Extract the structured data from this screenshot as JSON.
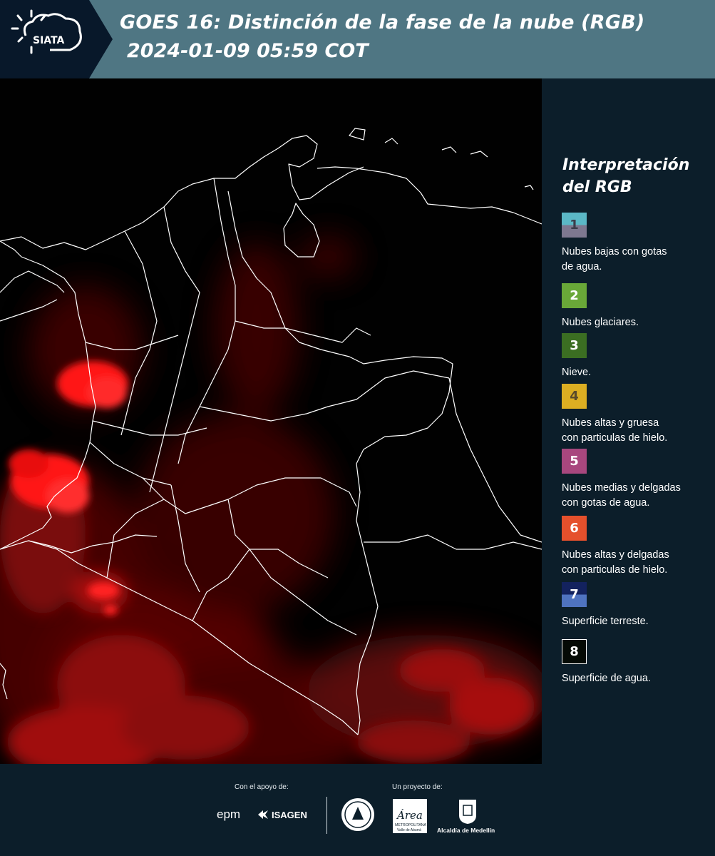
{
  "header": {
    "logo_text": "SIATA",
    "title_line1": "GOES 16: Distinción de la fase de la nube (RGB)",
    "title_line2": "2024-01-09 05:59 COT"
  },
  "legend": {
    "title_line1": "Interpretación",
    "title_line2": "del RGB",
    "items": [
      {
        "num": "1",
        "label_line1": "Nubes bajas con gotas",
        "label_line2": "de agua.",
        "color_top": "#5bb8c6",
        "color_bottom": "#7e7890",
        "text_color": "#3c3c4a"
      },
      {
        "num": "2",
        "label_line1": "Nubes glaciares.",
        "label_line2": "",
        "color_top": "#69a838",
        "color_bottom": "#69a838",
        "text_color": "#ffffff"
      },
      {
        "num": "3",
        "label_line1": "Nieve.",
        "label_line2": "",
        "color_top": "#3b6e22",
        "color_bottom": "#3b6e22",
        "text_color": "#ffffff"
      },
      {
        "num": "4",
        "label_line1": "Nubes altas y gruesa",
        "label_line2": "con particulas de hielo.",
        "color_top": "#dcae22",
        "color_bottom": "#dcae22",
        "text_color": "#5a4a2a"
      },
      {
        "num": "5",
        "label_line1": "Nubes medias y delgadas",
        "label_line2": "con gotas de agua.",
        "color_top": "#a8477e",
        "color_bottom": "#a8477e",
        "text_color": "#ffffff"
      },
      {
        "num": "6",
        "label_line1": "Nubes altas y delgadas",
        "label_line2": "con particulas de hielo.",
        "color_top": "#e5502c",
        "color_bottom": "#e5502c",
        "text_color": "#ffffff"
      },
      {
        "num": "7",
        "label_line1": "Superficie terreste.",
        "label_line2": "",
        "color_top": "#13225e",
        "color_bottom": "#4f73c0",
        "text_color": "#ffffff"
      },
      {
        "num": "8",
        "label_line1": "Superficie de agua.",
        "label_line2": "",
        "color_top": "#050a05",
        "color_bottom": "#050a05",
        "text_color": "#ffffff"
      }
    ]
  },
  "footer": {
    "support_caption": "Con el apoyo de:",
    "project_caption": "Un proyecto de:",
    "epm": "epm",
    "isagen": "ISAGEN",
    "area_name": "Área",
    "area_sub1": "METROPOLITANA",
    "area_sub2": "Valle de Aburrá",
    "alcaldia": "Alcaldía de Medellín"
  },
  "colors": {
    "header_bg": "#4f7683",
    "panel_bg": "#0c1e2a",
    "map_bg": "#010101",
    "cloud_red": "#ff1a1a",
    "border_white": "#ffffff"
  }
}
